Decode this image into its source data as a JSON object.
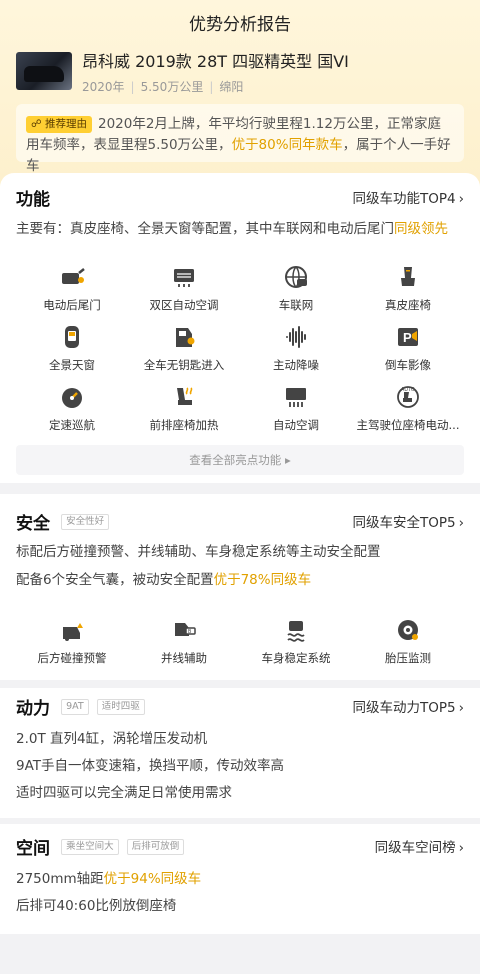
{
  "header": {
    "title": "优势分析报告"
  },
  "car": {
    "name": "昂科威 2019款 28T 四驱精英型 国VI",
    "year": "2020年",
    "mileage": "5.50万公里",
    "city": "绵阳"
  },
  "reason": {
    "tag": "推荐理由",
    "text_before": "2020年2月上牌，年平均行驶里程1.12万公里，正常家庭用车频率，表显里程5.50万公里，",
    "highlight": "优于80%同年款车",
    "text_after": "，属于个人一手好车"
  },
  "features": {
    "title": "功能",
    "link": "同级车功能TOP4",
    "desc_before": "主要有：真皮座椅、全景天窗等配置，其中车联网和电动后尾门",
    "desc_highlight": "同级领先",
    "items": [
      {
        "label": "电动后尾门",
        "icon": "power-tailgate-icon"
      },
      {
        "label": "双区自动空调",
        "icon": "dual-zone-ac-icon"
      },
      {
        "label": "车联网",
        "icon": "connected-car-icon"
      },
      {
        "label": "真皮座椅",
        "icon": "leather-seat-icon"
      },
      {
        "label": "全景天窗",
        "icon": "panoramic-sunroof-icon"
      },
      {
        "label": "全车无钥匙进入",
        "icon": "keyless-entry-icon"
      },
      {
        "label": "主动降噪",
        "icon": "noise-cancel-icon"
      },
      {
        "label": "倒车影像",
        "icon": "reverse-camera-icon"
      },
      {
        "label": "定速巡航",
        "icon": "cruise-control-icon"
      },
      {
        "label": "前排座椅加热",
        "icon": "seat-heating-icon"
      },
      {
        "label": "自动空调",
        "icon": "auto-ac-icon"
      },
      {
        "label": "主驾驶位座椅电动...",
        "icon": "power-seat-icon"
      }
    ],
    "more": "查看全部亮点功能"
  },
  "safety": {
    "title": "安全",
    "tags": [
      "安全性好"
    ],
    "link": "同级车安全TOP5",
    "line1": "标配后方碰撞预警、并线辅助、车身稳定系统等主动安全配置",
    "line2_before": "配备6个安全气囊，被动安全配置",
    "line2_highlight": "优于78%同级车",
    "items": [
      {
        "label": "后方碰撞预警",
        "icon": "rear-collision-warning-icon"
      },
      {
        "label": "并线辅助",
        "icon": "lane-change-assist-icon"
      },
      {
        "label": "车身稳定系统",
        "icon": "stability-control-icon"
      },
      {
        "label": "胎压监测",
        "icon": "tire-pressure-icon"
      }
    ]
  },
  "power": {
    "title": "动力",
    "tags": [
      "9AT",
      "适时四驱"
    ],
    "link": "同级车动力TOP5",
    "lines": [
      "2.0T 直列4缸，涡轮增压发动机",
      "9AT手自一体变速箱，换挡平顺，传动效率高",
      "适时四驱可以完全满足日常使用需求"
    ]
  },
  "space": {
    "title": "空间",
    "tags": [
      "乘坐空间大",
      "后排可放倒"
    ],
    "link": "同级车空间榜",
    "line1_before": "2750mm轴距",
    "line1_highlight": "优于94%同级车",
    "line2": "后排可40:60比例放倒座椅"
  },
  "colors": {
    "accent": "#e1a100",
    "tag_bg": "#ffcf33",
    "header_bg": "#fdf0cc"
  }
}
